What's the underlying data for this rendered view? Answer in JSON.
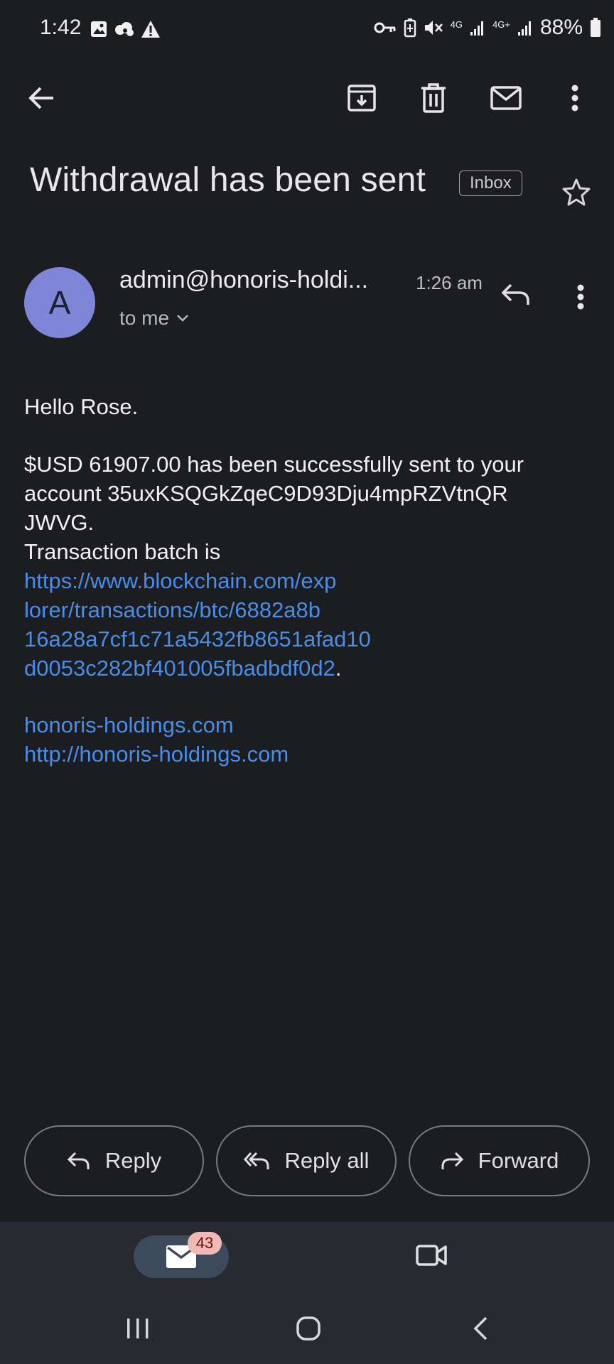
{
  "status_bar": {
    "time": "1:42",
    "network_1": "4G",
    "network_2": "4G+",
    "battery": "88%"
  },
  "message": {
    "subject": "Withdrawal has been sent",
    "label": "Inbox",
    "sender": "admin@honoris-holdi...",
    "avatar_letter": "A",
    "time": "1:26 am",
    "recipient": "to me",
    "body": {
      "greeting": "Hello Rose.",
      "line_amount": "$USD 61907.00 has been successfully sent to your",
      "line_account": "account 35uxKSQGkZqeC9D93Dju4mpRZVtnQR",
      "line_account_2": "JWVG.",
      "line_batch": "Transaction batch is",
      "link_lines": [
        "https://www.blockchain.com/exp",
        "lorer/transactions/btc/6882a8b",
        "16a28a7cf1c71a5432fb8651afad10",
        "d0053c282bf401005fbadbdf0d2"
      ],
      "link_end": ".",
      "site_link": "honoris-holdings.com",
      "site_url": "http://honoris-holdings.com"
    }
  },
  "actions": {
    "reply": "Reply",
    "reply_all": "Reply all",
    "forward": "Forward"
  },
  "bottom_nav": {
    "mail_badge": "43"
  },
  "icons": [
    "back-arrow-icon",
    "archive-icon",
    "trash-icon",
    "mark-unread-icon",
    "more-vert-icon",
    "star-icon",
    "reply-icon",
    "reply-all-icon",
    "forward-icon",
    "mail-icon",
    "video-icon",
    "recents-icon",
    "home-icon",
    "system-back-icon"
  ]
}
